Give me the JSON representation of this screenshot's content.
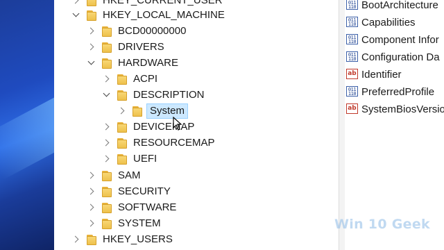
{
  "tree": {
    "partial_top": "HKEY_CURRENT_USER",
    "hklm": "HKEY_LOCAL_MACHINE",
    "bcd": "BCD00000000",
    "drivers": "DRIVERS",
    "hardware": "HARDWARE",
    "acpi": "ACPI",
    "description": "DESCRIPTION",
    "system_selected": "System",
    "devicemap": "DEVICEMAP",
    "resourcemap": "RESOURCEMAP",
    "uefi": "UEFI",
    "sam": "SAM",
    "security": "SECURITY",
    "software": "SOFTWARE",
    "system": "SYSTEM",
    "hku": "HKEY_USERS"
  },
  "values": [
    {
      "name": "BootArchitecture",
      "type": "binary"
    },
    {
      "name": "Capabilities",
      "type": "binary"
    },
    {
      "name": "Component Infor",
      "type": "binary"
    },
    {
      "name": "Configuration Da",
      "type": "binary"
    },
    {
      "name": "Identifier",
      "type": "string"
    },
    {
      "name": "PreferredProfile",
      "type": "binary"
    },
    {
      "name": "SystemBiosVersio",
      "type": "string"
    }
  ],
  "watermark": "Win 10 Geek"
}
